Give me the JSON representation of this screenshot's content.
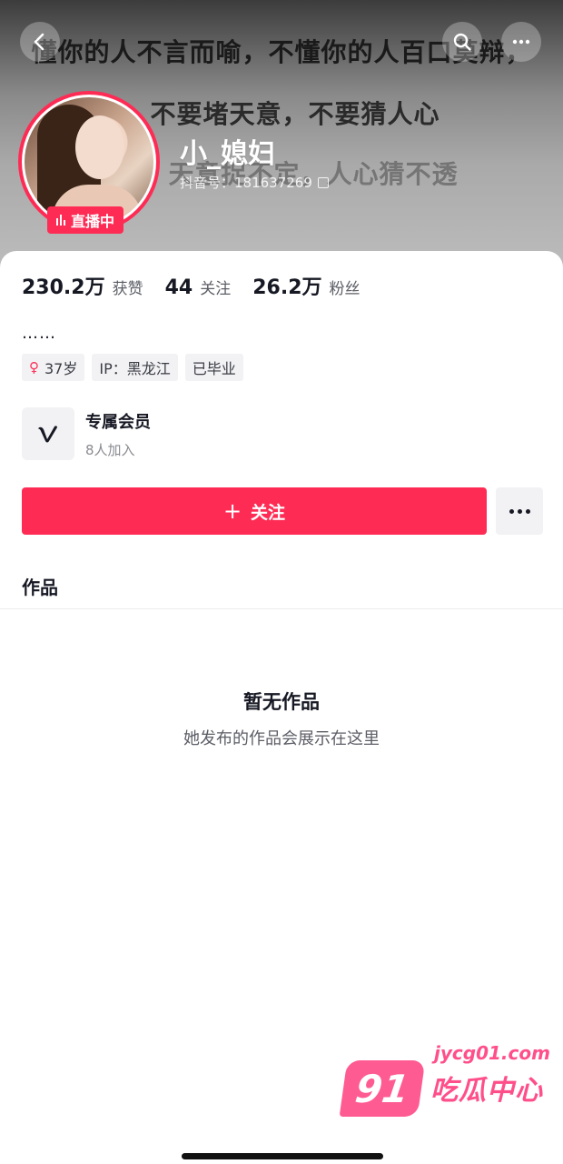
{
  "banner": {
    "line1": "懂你的人不言而喻，不懂你的人百口莫辩，",
    "line2": "不要堵天意，不要猜人心",
    "line3": "天意捉不定，人心猜不透"
  },
  "profile": {
    "nickname": "小_媳妇",
    "douyin_id": "抖音号：181637269",
    "live_badge": "直播中"
  },
  "stats": [
    {
      "num": "230.2万",
      "label": "获赞"
    },
    {
      "num": "44",
      "label": "关注"
    },
    {
      "num": "26.2万",
      "label": "粉丝"
    }
  ],
  "bio": "……",
  "tags": {
    "age": "37岁",
    "ip": "IP：黑龙江",
    "status": "已毕业"
  },
  "member": {
    "title": "专属会员",
    "subtitle": "8人加入"
  },
  "actions": {
    "follow_label": "关注"
  },
  "tabs": {
    "works": "作品"
  },
  "empty_state": {
    "title": "暂无作品",
    "subtitle": "她发布的作品会展示在这里"
  },
  "watermark": {
    "url": "jycg01.com",
    "logo_number": "91",
    "text": "吃瓜中心"
  },
  "colors": {
    "accent": "#fe2c55",
    "watermark": "#ff4f8b"
  }
}
